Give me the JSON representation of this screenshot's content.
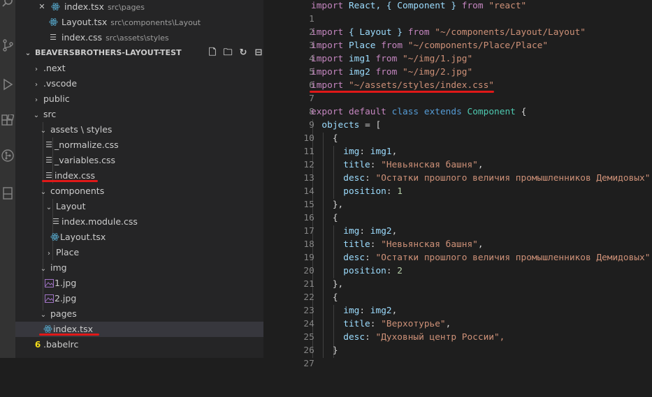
{
  "sidebar": {
    "open_editors": [
      {
        "name": "index.tsx",
        "path": "src\\pages",
        "icon": "react-icon"
      },
      {
        "name": "Layout.tsx",
        "path": "src\\components\\Layout",
        "icon": "react-icon"
      },
      {
        "name": "index.css",
        "path": "src\\assets\\styles",
        "icon": "lines-icon"
      }
    ],
    "project_title": "BEAVERSBROTHERS-LAYOUT-TEST",
    "tree": {
      "next": ".next",
      "vscode": ".vscode",
      "public": "public",
      "src": "src",
      "assets_styles": "assets \\ styles",
      "normalize": "_normalize.css",
      "variables": "_variables.css",
      "index_css": "index.css",
      "components": "components",
      "layout": "Layout",
      "index_module": "index.module.css",
      "layout_tsx": "Layout.tsx",
      "place": "Place",
      "img": "img",
      "jpg1": "1.jpg",
      "jpg2": "2.jpg",
      "pages": "pages",
      "index_tsx": "index.tsx",
      "babelrc": ".babelrc"
    }
  },
  "editor": {
    "line_numbers": [
      "1",
      "2",
      "3",
      "4",
      "5",
      "6",
      "7",
      "8",
      "9",
      "10",
      "11",
      "12",
      "13",
      "14",
      "15",
      "16",
      "17",
      "18",
      "19",
      "20",
      "21",
      "22",
      "23",
      "24",
      "25",
      "26",
      "27"
    ],
    "code": {
      "l1": [
        "import",
        "React, { Component }",
        "from",
        "\"react\""
      ],
      "l3": [
        "import",
        "{ Layout }",
        "from",
        "\"~/components/Layout/Layout\""
      ],
      "l4": [
        "import",
        "Place",
        "from",
        "\"~/components/Place/Place\""
      ],
      "l5": [
        "import",
        "img1",
        "from",
        "\"~/img/1.jpg\""
      ],
      "l6": [
        "import",
        "img2",
        "from",
        "\"~/img/2.jpg\""
      ],
      "l7": [
        "import",
        "\"~/assets/styles/index.css\""
      ],
      "l9": [
        "export",
        "default",
        "class",
        "extends",
        "Component",
        "{"
      ],
      "l10": [
        "objects",
        " = ["
      ],
      "open_brace": "{",
      "close_brace": "},",
      "img_key": "img",
      "title_key": "title",
      "desc_key": "desc",
      "position_key": "position",
      "img1": "img1",
      "img2": "img2",
      "title_tower": "\"Невьянская башня\"",
      "desc_tower": "\"Остатки прошлого величия промышленников Демидовых\",",
      "pos1": "1",
      "pos2": "2",
      "title_verkh": "\"Верхотурье\"",
      "desc_verkh": "\"Духовный центр России\",",
      "l27": "}"
    }
  }
}
